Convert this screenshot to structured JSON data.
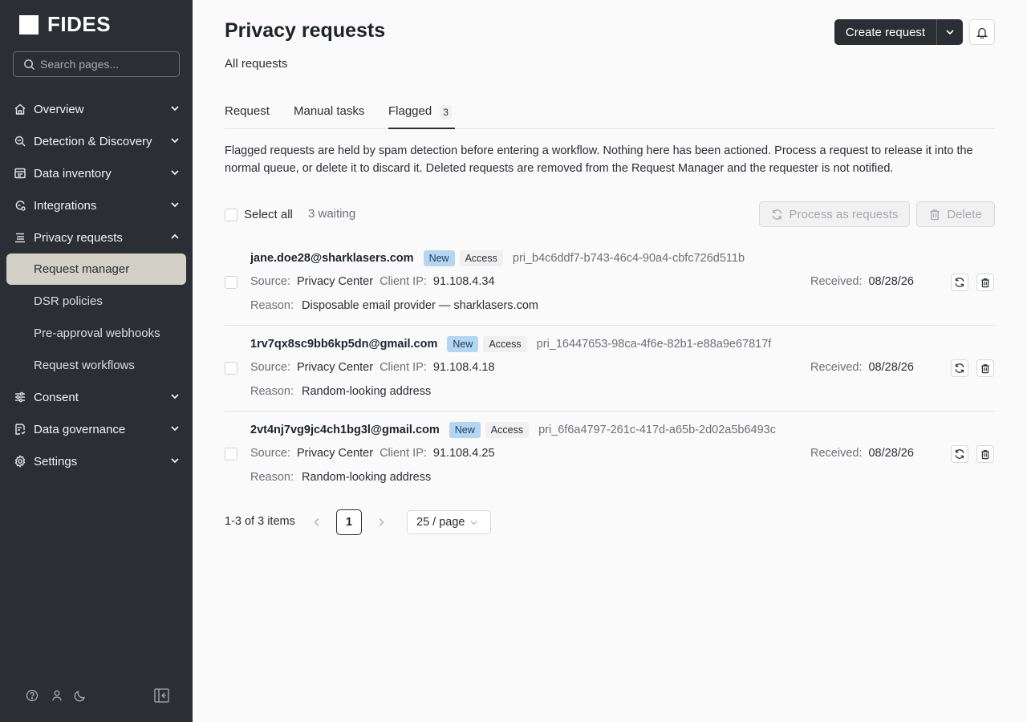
{
  "brand": {
    "name": "FIDES"
  },
  "search": {
    "placeholder": "Search pages..."
  },
  "nav": {
    "items": [
      {
        "label": "Overview"
      },
      {
        "label": "Detection & Discovery"
      },
      {
        "label": "Data inventory"
      },
      {
        "label": "Integrations"
      },
      {
        "label": "Privacy requests"
      },
      {
        "label": "Consent"
      },
      {
        "label": "Data governance"
      },
      {
        "label": "Settings"
      }
    ],
    "privacy_sub": [
      {
        "label": "Request manager"
      },
      {
        "label": "DSR policies"
      },
      {
        "label": "Pre-approval webhooks"
      },
      {
        "label": "Request workflows"
      }
    ]
  },
  "header": {
    "title": "Privacy requests",
    "subtitle": "All requests",
    "create_label": "Create request"
  },
  "tabs": [
    {
      "label": "Request"
    },
    {
      "label": "Manual tasks"
    },
    {
      "label": "Flagged",
      "count": "3"
    }
  ],
  "description": "Flagged requests are held by spam detection before entering a workflow. Nothing here has been actioned. Process a request to release it into the normal queue, or delete it to discard it. Deleted requests are removed from the Request Manager and the requester is not notified.",
  "bulk": {
    "select_all": "Select all",
    "waiting": "3 waiting",
    "process_label": "Process as requests",
    "delete_label": "Delete"
  },
  "labels": {
    "source": "Source:",
    "client_ip": "Client IP:",
    "reason": "Reason:",
    "received": "Received:"
  },
  "requests": [
    {
      "email": "jane.doe28@sharklasers.com",
      "status": "New",
      "type": "Access",
      "id": "pri_b4c6ddf7-b743-46c4-90a4-cbfc726d511b",
      "source": "Privacy Center",
      "ip": "91.108.4.34",
      "reason": "Disposable email provider — sharklasers.com",
      "received": "08/28/26"
    },
    {
      "email": "1rv7qx8sc9bb6kp5dn@gmail.com",
      "status": "New",
      "type": "Access",
      "id": "pri_16447653-98ca-4f6e-82b1-e88a9e67817f",
      "source": "Privacy Center",
      "ip": "91.108.4.18",
      "reason": "Random-looking address",
      "received": "08/28/26"
    },
    {
      "email": "2vt4nj7vg9jc4ch1bg3l@gmail.com",
      "status": "New",
      "type": "Access",
      "id": "pri_6f6a4797-261c-417d-a65b-2d02a5b6493c",
      "source": "Privacy Center",
      "ip": "91.108.4.25",
      "reason": "Random-looking address",
      "received": "08/28/26"
    }
  ],
  "pagination": {
    "total": "1-3 of 3 items",
    "current": "1",
    "page_size": "25 / page"
  },
  "colors": {
    "sidebar_bg": "#2b2e33",
    "active_item_bg": "#d3d0c7",
    "new_tag_bg": "#b3d6f2",
    "primary_button": "#2b2e33"
  },
  "icons": [
    "home-icon",
    "search-icon",
    "inventory-icon",
    "integrations-icon",
    "privacy-icon",
    "consent-icon",
    "governance-icon",
    "settings-icon",
    "bell-icon",
    "refresh-icon",
    "trash-icon",
    "help-icon",
    "user-icon",
    "moon-icon",
    "collapse-icon"
  ]
}
